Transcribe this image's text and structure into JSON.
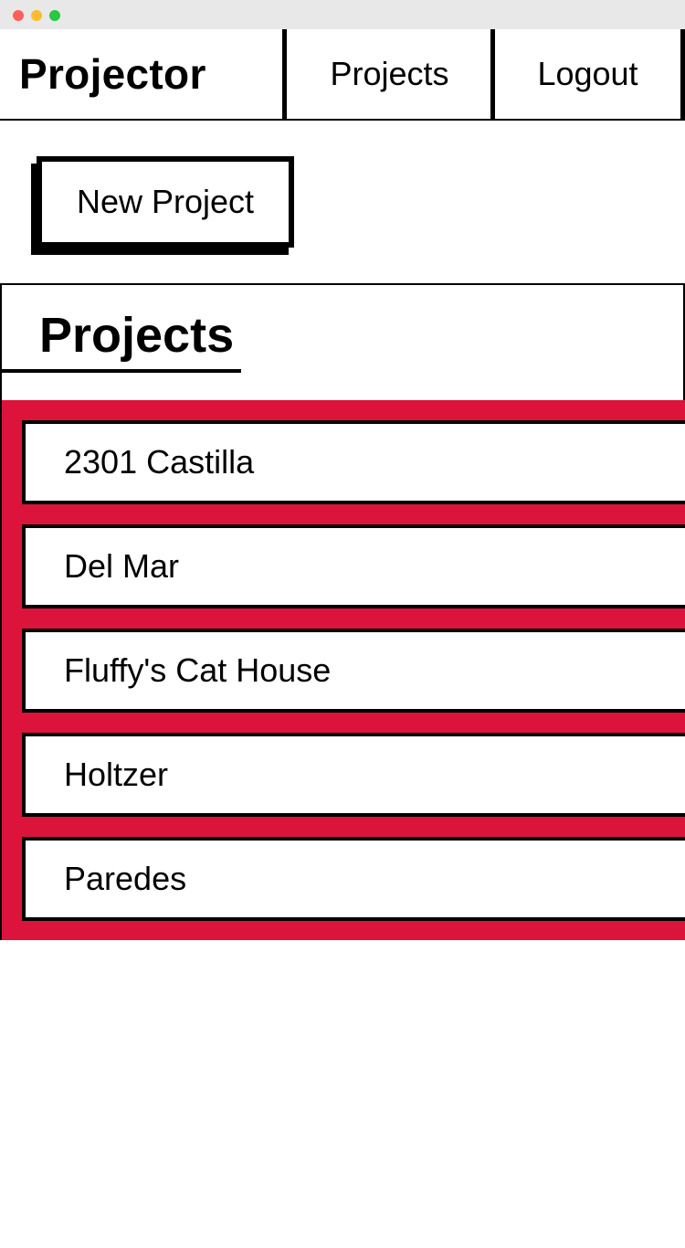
{
  "header": {
    "brand": "Projector",
    "nav": {
      "projects_label": "Projects",
      "logout_label": "Logout"
    }
  },
  "actions": {
    "new_project_label": "New Project"
  },
  "projects_panel": {
    "title": "Projects",
    "accent_color": "#dc143c",
    "items": [
      {
        "label": "2301 Castilla"
      },
      {
        "label": "Del Mar"
      },
      {
        "label": "Fluffy's Cat House"
      },
      {
        "label": "Holtzer"
      },
      {
        "label": "Paredes"
      }
    ]
  }
}
